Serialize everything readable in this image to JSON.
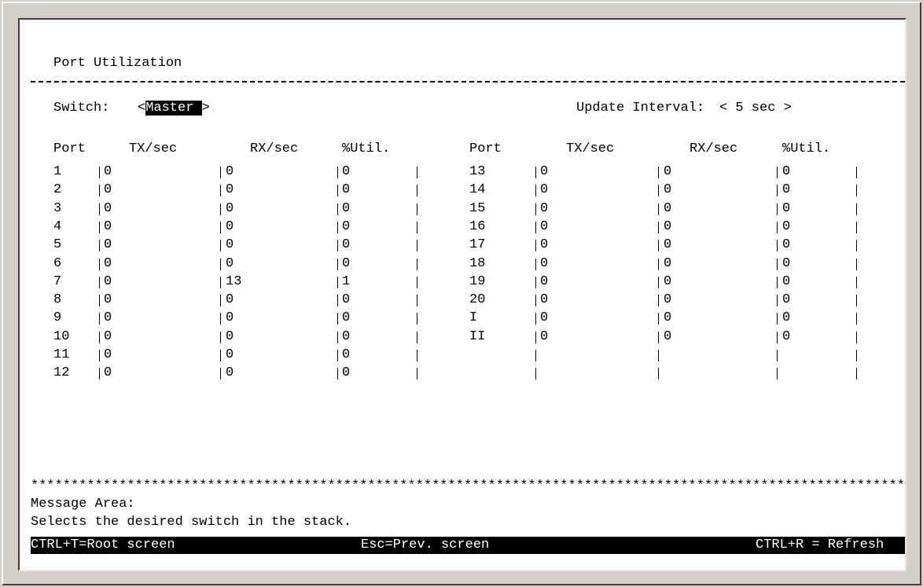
{
  "title": "Port Utilization",
  "switch": {
    "label": "Switch:",
    "value": "Master"
  },
  "update_interval": {
    "label": "Update Interval:",
    "value": "5 sec"
  },
  "columns": [
    "Port",
    "TX/sec",
    "RX/sec",
    "%Util."
  ],
  "left_rows": [
    {
      "port": "1",
      "tx": "0",
      "rx": "0",
      "util": "0"
    },
    {
      "port": "2",
      "tx": "0",
      "rx": "0",
      "util": "0"
    },
    {
      "port": "3",
      "tx": "0",
      "rx": "0",
      "util": "0"
    },
    {
      "port": "4",
      "tx": "0",
      "rx": "0",
      "util": "0"
    },
    {
      "port": "5",
      "tx": "0",
      "rx": "0",
      "util": "0"
    },
    {
      "port": "6",
      "tx": "0",
      "rx": "0",
      "util": "0"
    },
    {
      "port": "7",
      "tx": "0",
      "rx": "13",
      "util": "1"
    },
    {
      "port": "8",
      "tx": "0",
      "rx": "0",
      "util": "0"
    },
    {
      "port": "9",
      "tx": "0",
      "rx": "0",
      "util": "0"
    },
    {
      "port": "10",
      "tx": "0",
      "rx": "0",
      "util": "0"
    },
    {
      "port": "11",
      "tx": "0",
      "rx": "0",
      "util": "0"
    },
    {
      "port": "12",
      "tx": "0",
      "rx": "0",
      "util": "0"
    }
  ],
  "right_rows": [
    {
      "port": "13",
      "tx": "0",
      "rx": "0",
      "util": "0"
    },
    {
      "port": "14",
      "tx": "0",
      "rx": "0",
      "util": "0"
    },
    {
      "port": "15",
      "tx": "0",
      "rx": "0",
      "util": "0"
    },
    {
      "port": "16",
      "tx": "0",
      "rx": "0",
      "util": "0"
    },
    {
      "port": "17",
      "tx": "0",
      "rx": "0",
      "util": "0"
    },
    {
      "port": "18",
      "tx": "0",
      "rx": "0",
      "util": "0"
    },
    {
      "port": "19",
      "tx": "0",
      "rx": "0",
      "util": "0"
    },
    {
      "port": "20",
      "tx": "0",
      "rx": "0",
      "util": "0"
    },
    {
      "port": "I",
      "tx": "0",
      "rx": "0",
      "util": "0"
    },
    {
      "port": "II",
      "tx": "0",
      "rx": "0",
      "util": "0"
    },
    {
      "port": "",
      "tx": "",
      "rx": "",
      "util": ""
    },
    {
      "port": "",
      "tx": "",
      "rx": "",
      "util": ""
    }
  ],
  "separator_stars": "************************************************************************************************************************",
  "message_area": {
    "label": "Message Area:",
    "text": "Selects the desired switch in the stack."
  },
  "footer": {
    "root": "CTRL+T=Root screen",
    "prev": "Esc=Prev. screen",
    "refresh": "CTRL+R = Refresh"
  }
}
